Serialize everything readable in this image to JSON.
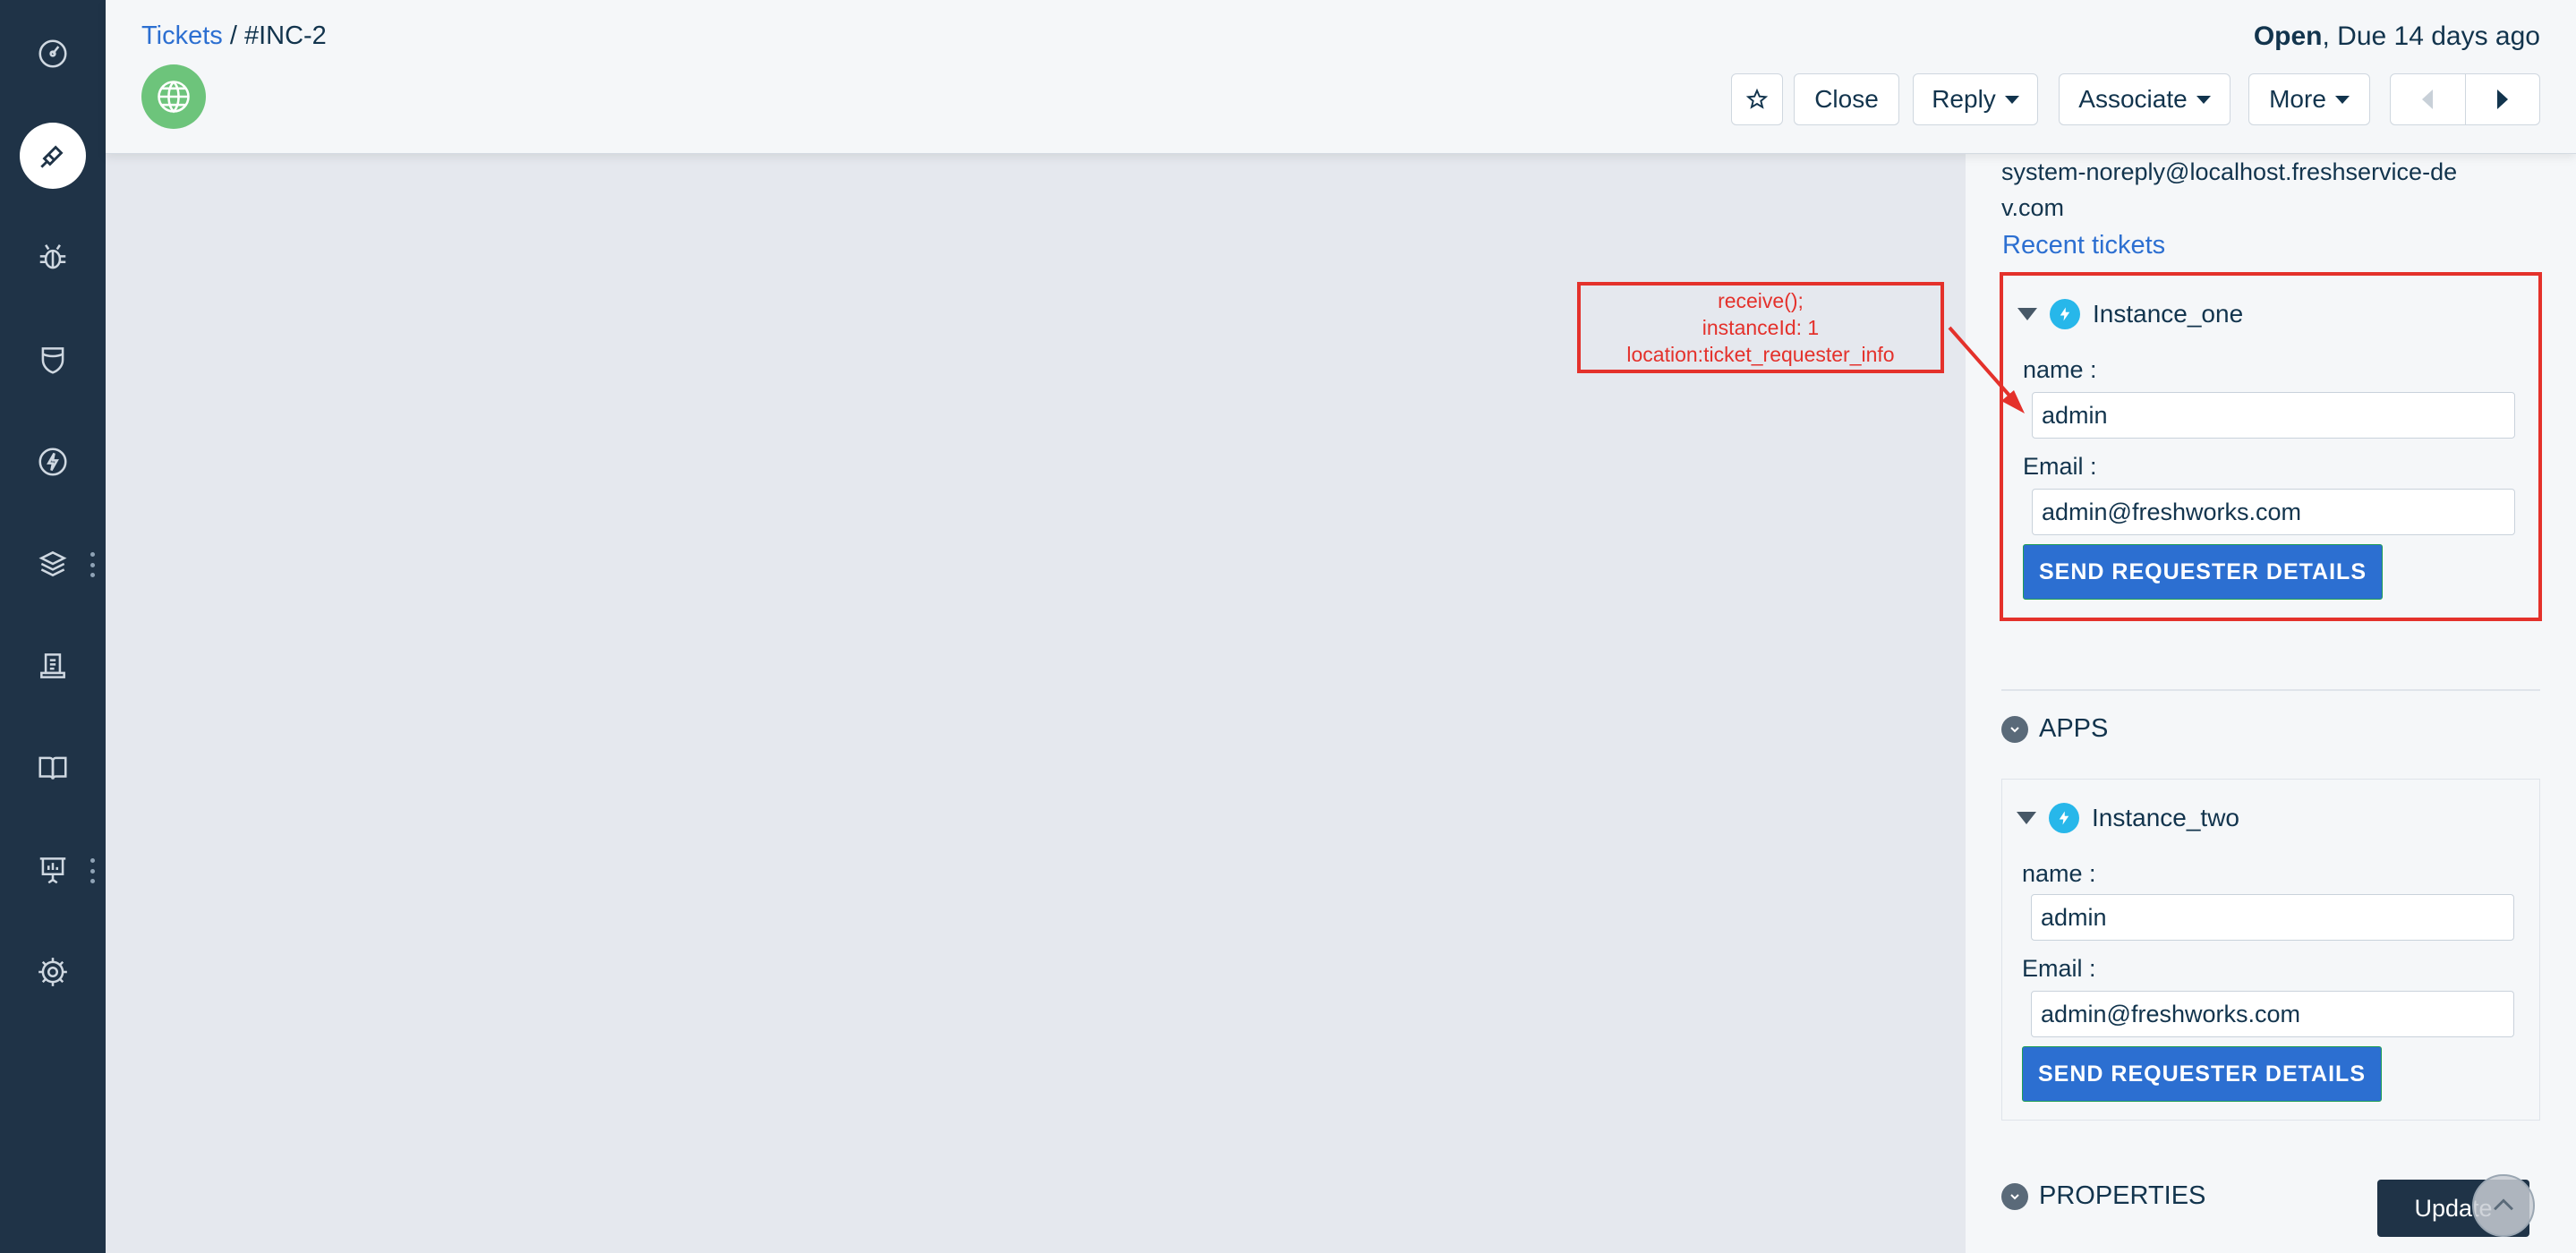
{
  "header": {
    "breadcrumb_link": "Tickets",
    "breadcrumb_sep": " / ",
    "breadcrumb_current": "#INC-2",
    "status_strong": "Open",
    "status_rest": ", Due 14 days ago"
  },
  "toolbar": {
    "close_label": "Close",
    "reply_label": "Reply",
    "associate_label": "Associate",
    "more_label": "More"
  },
  "annotation": {
    "line1": "receive();",
    "line2": "instanceId: 1",
    "line3": "location:ticket_requester_info"
  },
  "requester": {
    "email_line1": "system-noreply@localhost.freshservice-de",
    "email_line2": "v.com",
    "recent_tickets": "Recent tickets"
  },
  "instance_one": {
    "title": "Instance_one",
    "name_label": "name :",
    "name_value": "admin",
    "email_label": "Email :",
    "email_value": "admin@freshworks.com",
    "button_label": "SEND REQUESTER DETAILS"
  },
  "apps_section": {
    "title": "APPS"
  },
  "instance_two": {
    "title": "Instance_two",
    "name_label": "name :",
    "name_value": "admin",
    "email_label": "Email :",
    "email_value": "admin@freshworks.com",
    "button_label": "SEND REQUESTER DETAILS"
  },
  "properties_section": {
    "title": "PROPERTIES"
  },
  "footer": {
    "update_label": "Update"
  },
  "colors": {
    "nav_bg": "#1f3347",
    "link": "#2c6fd1",
    "primary_button": "#2c6fd1",
    "annotation": "#e4312b",
    "app_icon": "#27b7ea",
    "avatar": "#6dc47b"
  },
  "icons": {
    "nav": [
      "dashboard-icon",
      "tickets-icon",
      "problems-icon",
      "changes-icon",
      "releases-icon",
      "assets-icon",
      "contracts-icon",
      "solutions-icon",
      "analytics-icon",
      "admin-gear-icon"
    ]
  }
}
